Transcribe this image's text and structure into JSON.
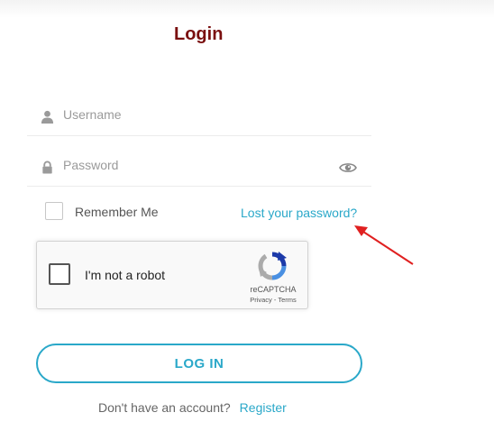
{
  "form": {
    "title": "Login",
    "username": {
      "placeholder": "Username",
      "value": ""
    },
    "password": {
      "placeholder": "Password",
      "value": ""
    },
    "remember_label": "Remember Me",
    "lost_password_label": "Lost your password?",
    "login_button_label": "LOG IN",
    "no_account_text": "Don't have an account?",
    "register_label": "Register"
  },
  "recaptcha": {
    "label": "I'm not a robot",
    "brand": "reCAPTCHA",
    "privacy": "Privacy",
    "separator": " - ",
    "terms": "Terms"
  },
  "colors": {
    "title": "#7a1010",
    "accent": "#2aa8c9",
    "annotation_arrow": "#e02020"
  },
  "icons": [
    "user-icon",
    "lock-icon",
    "eye-icon",
    "recaptcha-logo-icon",
    "annotation-arrow"
  ]
}
